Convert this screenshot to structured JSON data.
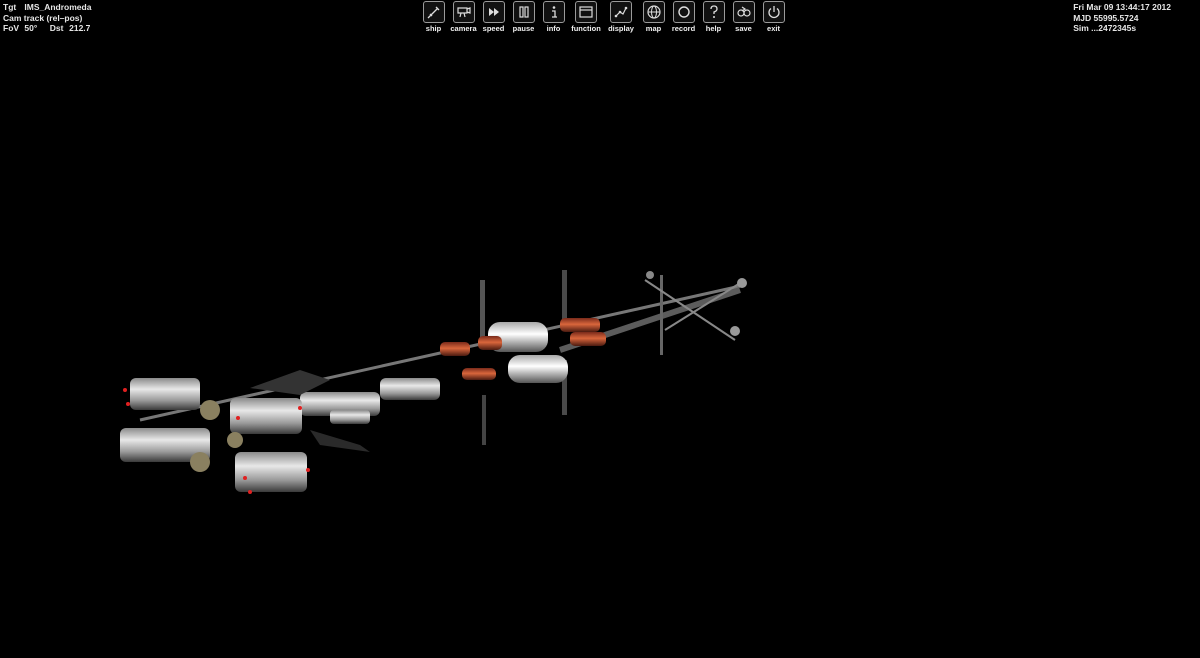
{
  "hud_left": {
    "tgt_label": "Tgt",
    "tgt_value": "IMS_Andromeda",
    "cam_mode": "Cam track (rel–pos)",
    "fov_label": "FoV",
    "fov_value": "50°",
    "dst_label": "Dst",
    "dst_value": "212.7"
  },
  "hud_right": {
    "date": "Fri Mar 09 13:44:17 2012",
    "mjd_label": "MJD",
    "mjd_value": "55995.5724",
    "sim_label": "Sim",
    "sim_value": "...2472345s"
  },
  "toolbar": [
    {
      "label": "ship",
      "icon": "ship-icon"
    },
    {
      "label": "camera",
      "icon": "camera-icon"
    },
    {
      "label": "speed",
      "icon": "fast-forward-icon"
    },
    {
      "label": "pause",
      "icon": "pause-icon"
    },
    {
      "label": "info",
      "icon": "info-icon"
    },
    {
      "label": "function",
      "icon": "window-icon"
    },
    {
      "label": "display",
      "icon": "display-icon"
    },
    {
      "label": "map",
      "icon": "globe-icon"
    },
    {
      "label": "record",
      "icon": "record-icon"
    },
    {
      "label": "help",
      "icon": "help-icon"
    },
    {
      "label": "save",
      "icon": "save-icon"
    },
    {
      "label": "exit",
      "icon": "power-icon"
    }
  ],
  "scene": {
    "vessel": "IMS_Andromeda space station",
    "background_color": "#000000"
  }
}
